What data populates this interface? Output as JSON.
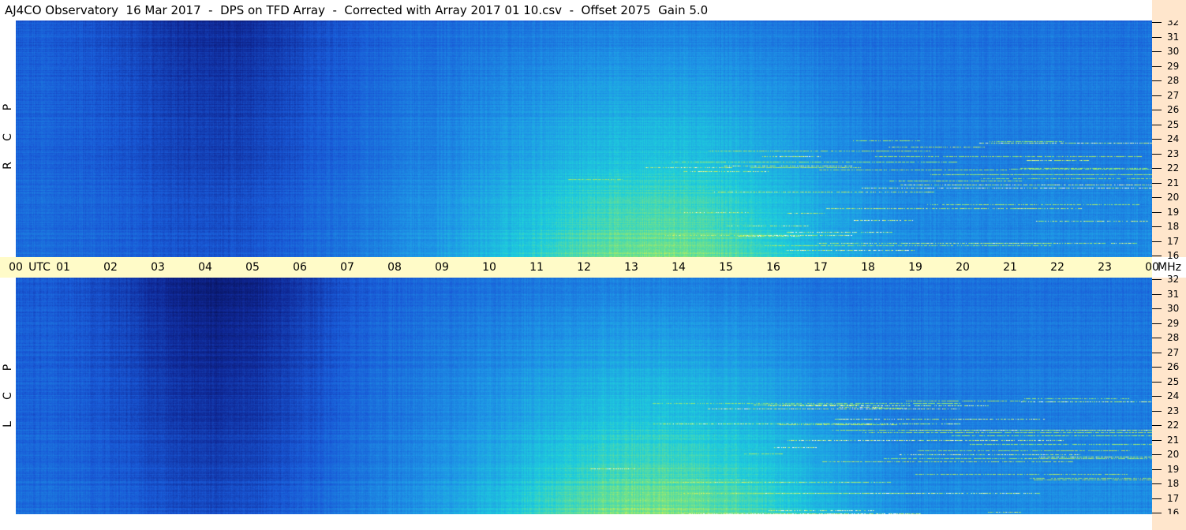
{
  "title": "AJ4CO Observatory  16 Mar 2017  -  DPS on TFD Array  -  Corrected with Array 2017 01 10.csv  -  Offset 2075  Gain 5.0",
  "chart_data": [
    {
      "type": "heatmap",
      "polarization": "RCP",
      "side_label": [
        "R",
        "C",
        "P"
      ],
      "x_range_utc_hours": [
        0,
        24
      ],
      "y_range_mhz": [
        16,
        32
      ],
      "y_ticks": [
        "16",
        "17",
        "18",
        "19",
        "20",
        "21",
        "22",
        "23",
        "24",
        "25",
        "26",
        "27",
        "28",
        "29",
        "30",
        "31",
        "32"
      ]
    },
    {
      "type": "heatmap",
      "polarization": "LCP",
      "side_label": [
        "L",
        "C",
        "P"
      ],
      "x_range_utc_hours": [
        0,
        24
      ],
      "y_range_mhz": [
        16,
        32
      ],
      "y_ticks": [
        "16",
        "17",
        "18",
        "19",
        "20",
        "21",
        "22",
        "23",
        "24",
        "25",
        "26",
        "27",
        "28",
        "29",
        "30",
        "31",
        "32"
      ]
    }
  ],
  "time_axis": {
    "ticks": [
      "00",
      "01",
      "02",
      "03",
      "04",
      "05",
      "06",
      "07",
      "08",
      "09",
      "10",
      "11",
      "12",
      "13",
      "14",
      "15",
      "16",
      "17",
      "18",
      "19",
      "20",
      "21",
      "22",
      "23",
      "00"
    ],
    "utc_label": "UTC",
    "unit_label": "MHz"
  },
  "colors": {
    "background": "#ffffff",
    "time_axis_bg": "#fffbc8",
    "freq_axis_bg": "#ffe6cc",
    "dark_blue": "#0a1a6a",
    "mid_blue": "#1f5ad8",
    "cyan": "#20c8e0",
    "green": "#90e060"
  }
}
